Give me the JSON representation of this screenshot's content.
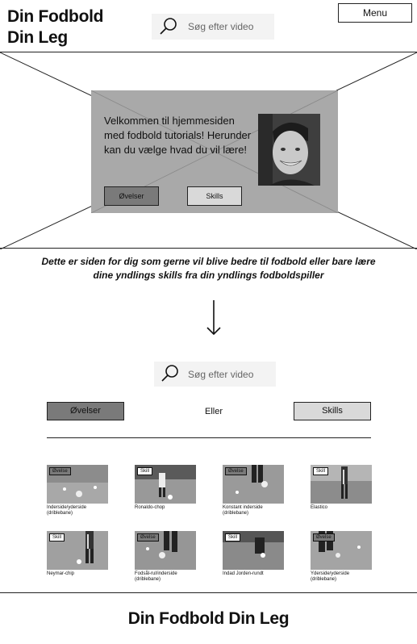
{
  "header": {
    "logo_line1": "Din Fodbold",
    "logo_line2": "Din Leg",
    "search_placeholder": "Søg efter video",
    "menu_label": "Menu"
  },
  "hero": {
    "welcome_text": "Velkommen til hjemmesiden med fodbold tutorials! Herunder kan du vælge hvad du vil lære!",
    "btn_ovelser": "Øvelser",
    "btn_skills": "Skills"
  },
  "tagline": "Dette er siden for dig som gerne vil blive bedre til fodbold eller bare lære dine yndlings skills fra din yndlings fodboldspiller",
  "section": {
    "search_placeholder": "Søg efter video",
    "tab_ovelser": "Øvelser",
    "or_label": "Eller",
    "tab_skills": "Skills"
  },
  "videos": [
    {
      "tag": "Øvelse",
      "kind": "ovelse",
      "title": "Inderside/yderside (driblebane)"
    },
    {
      "tag": "Skill",
      "kind": "skill",
      "title": "Ronaldo-chop"
    },
    {
      "tag": "Øvelse",
      "kind": "ovelse",
      "title": "Konstant inderside (driblebane)"
    },
    {
      "tag": "Skill",
      "kind": "skill",
      "title": "Elastico"
    },
    {
      "tag": "Skill",
      "kind": "skill",
      "title": "Neymar-chip"
    },
    {
      "tag": "Øvelse",
      "kind": "ovelse",
      "title": "Fodsål-rul/inderside (driblebane)"
    },
    {
      "tag": "Skill",
      "kind": "skill",
      "title": "Indad Jorden-rundt"
    },
    {
      "tag": "Øvelse",
      "kind": "ovelse",
      "title": "Yderside/yderside (driblebane)"
    }
  ],
  "footer": {
    "title": "Din Fodbold Din Leg"
  },
  "colors": {
    "card_gray": "#a9a9a9",
    "ovelser_gray": "#7a7a7a",
    "skills_gray": "#d9d9d9"
  }
}
